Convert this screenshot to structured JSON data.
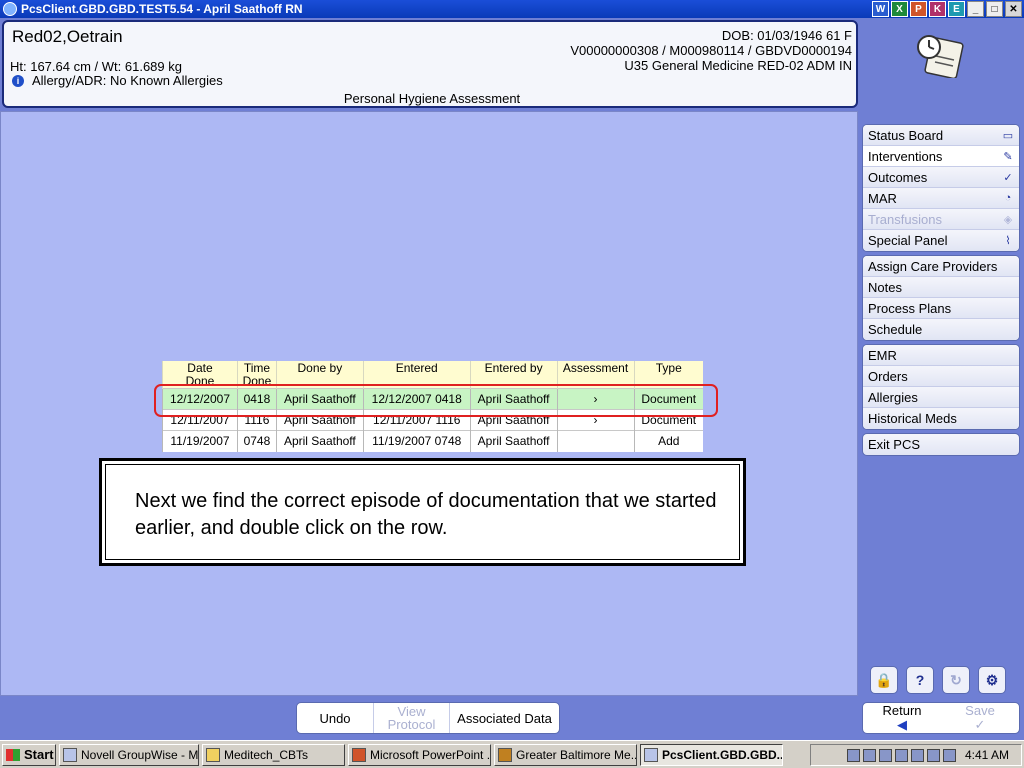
{
  "window": {
    "title": "PcsClient.GBD.GBD.TEST5.54 - April Saathoff RN"
  },
  "title_tools": [
    "W",
    "X",
    "P",
    "K",
    "E"
  ],
  "patient": {
    "name": "Red02,Oetrain",
    "ht_wt": "Ht: 167.64 cm / Wt: 61.689 kg",
    "allergy": "Allergy/ADR: No Known Allergies",
    "dob": "DOB: 01/03/1946 61 F",
    "ids": "V00000000308 / M000980114 / GBDVD0000194",
    "location": "U35 General Medicine  RED-02  ADM IN"
  },
  "screen_title": "Personal Hygiene Assessment",
  "table": {
    "headers": [
      "Date\nDone",
      "Time\nDone",
      "Done by",
      "Entered",
      "Entered by",
      "Assessment",
      "Type"
    ],
    "rows": [
      [
        "12/12/2007",
        "0418",
        "April Saathoff",
        "12/12/2007 0418",
        "April Saathoff",
        "›",
        "Document"
      ],
      [
        "12/11/2007",
        "1116",
        "April Saathoff",
        "12/11/2007 1116",
        "April Saathoff",
        "›",
        "Document"
      ],
      [
        "11/19/2007",
        "0748",
        "April Saathoff",
        "11/19/2007 0748",
        "April Saathoff",
        "",
        "Add"
      ]
    ]
  },
  "callout": {
    "text": "Next we find the correct episode of documentation that we started earlier, and double click on the row."
  },
  "sidebar": {
    "group1": [
      {
        "label": "Status Board",
        "icon": "book-icon",
        "glyph": "▭"
      },
      {
        "label": "Interventions",
        "icon": "clipboard-icon",
        "glyph": "✎"
      },
      {
        "label": "Outcomes",
        "icon": "check-clipboard-icon",
        "glyph": "✓"
      },
      {
        "label": "MAR",
        "icon": "clock-note-icon",
        "glyph": "◔"
      },
      {
        "label": "Transfusions",
        "icon": "blood-bag-icon",
        "glyph": "◈"
      },
      {
        "label": "Special Panel",
        "icon": "pulse-icon",
        "glyph": "⌇"
      }
    ],
    "group2": [
      "Assign Care Providers",
      "Notes",
      "Process Plans",
      "Schedule"
    ],
    "group3": [
      "EMR",
      "Orders",
      "Allergies",
      "Historical Meds"
    ],
    "group4": [
      "Exit PCS"
    ]
  },
  "side_tools": [
    "🔒",
    "?",
    "↻",
    "⚙"
  ],
  "return_bar": {
    "return_label": "Return",
    "return_arrow": "◀",
    "save_label": "Save",
    "save_check": "✓"
  },
  "bottom_buttons": {
    "undo": "Undo",
    "view_protocol": "View\nProtocol",
    "associated_data": "Associated Data"
  },
  "taskbar": {
    "start": "Start",
    "tasks": [
      "Novell GroupWise - M...",
      "Meditech_CBTs",
      "Microsoft PowerPoint ...",
      "Greater Baltimore Me...",
      "PcsClient.GBD.GBD...."
    ],
    "clock": "4:41 AM"
  },
  "colors": {
    "accent": "#1a4ed8",
    "selected_row": "#c8f4c4",
    "highlight_ring": "#e02020",
    "workspace": "#adb8f4"
  }
}
